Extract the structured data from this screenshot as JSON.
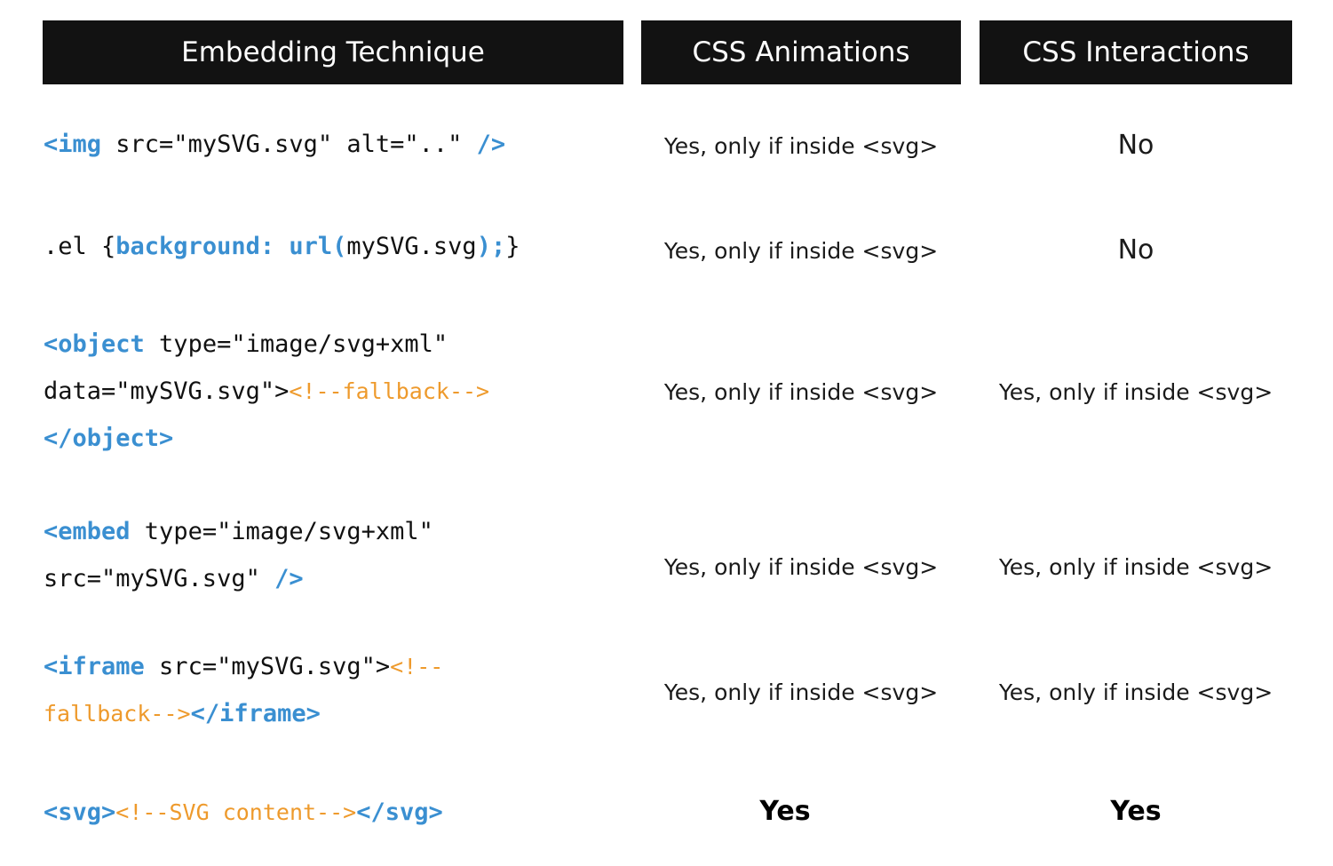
{
  "headers": {
    "technique": "Embedding Technique",
    "animations": "CSS Animations",
    "interactions": "CSS Interactions"
  },
  "rows": [
    {
      "code": {
        "line1_tag_open": "<img",
        "line1_attrs": " src=\"mySVG.svg\" alt=\"..\" ",
        "line1_tag_close": "/>"
      },
      "animations": "Yes, only if inside <svg>",
      "interactions": "No"
    },
    {
      "code": {
        "selector": ".el {",
        "property": "background:",
        "func": "url(",
        "arg": "mySVG.svg",
        "close_paren": ");",
        "close_brace": "}"
      },
      "animations": "Yes, only if inside <svg>",
      "interactions": "No"
    },
    {
      "code": {
        "line1_tag_open": "<object",
        "line1_attrs": " type=\"image/svg+xml\"",
        "line2_attrs": "data=\"mySVG.svg\">",
        "line2_comment": "<!--fallback-->",
        "line3_tag_close": "</object>"
      },
      "animations": "Yes, only if inside <svg>",
      "interactions": "Yes, only if inside <svg>"
    },
    {
      "code": {
        "line1_tag_open": "<embed",
        "line1_attrs": " type=\"image/svg+xml\"",
        "line2_attrs": "src=\"mySVG.svg\" ",
        "line2_tag_close": "/>"
      },
      "animations": "Yes, only if inside <svg>",
      "interactions": "Yes, only if inside <svg>"
    },
    {
      "code": {
        "line1_tag_open": "<iframe",
        "line1_attrs": " src=\"mySVG.svg\">",
        "line1_comment": "<!--",
        "line2_comment": "fallback-->",
        "line2_tag_close": "</iframe>"
      },
      "animations": "Yes, only if inside <svg>",
      "interactions": "Yes, only if inside <svg>"
    },
    {
      "code": {
        "tag_open": "<svg>",
        "comment": "<!--SVG content-->",
        "tag_close": "</svg>"
      },
      "animations": "Yes",
      "interactions": "Yes"
    }
  ],
  "colors": {
    "header_bg": "#121212",
    "keyword": "#3a8fd1",
    "comment": "#ee9a2c"
  }
}
